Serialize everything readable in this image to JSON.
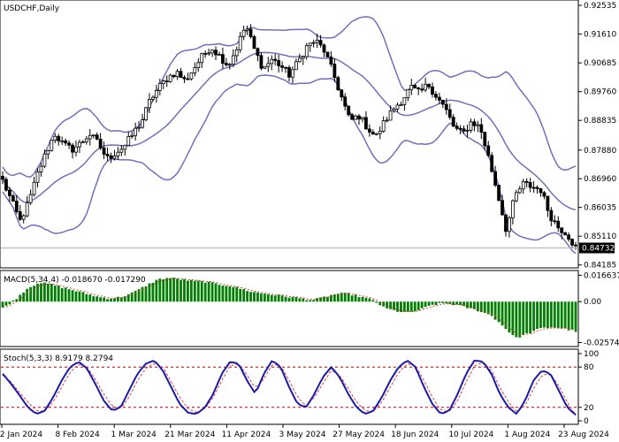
{
  "chart_data": [
    {
      "type": "candlestick",
      "title": "USDCHF,Daily",
      "y_ticks": [
        "0.92535",
        "0.91610",
        "0.90685",
        "0.89760",
        "0.88835",
        "0.87880",
        "0.86960",
        "0.86035",
        "0.85110",
        "0.84185"
      ],
      "ylim": [
        0.8412,
        0.9265
      ],
      "current_price": "0.84732",
      "x_ticks": [
        "2 Jan 2024",
        "8 Feb 2024",
        "1 Mar 2024",
        "21 Mar 2024",
        "11 Apr 2024",
        "3 May 2024",
        "27 May 2024",
        "18 Jun 2024",
        "10 Jul 2024",
        "1 Aug 2024",
        "23 Aug 2024"
      ],
      "close_path": [
        0.869,
        0.8625,
        0.856,
        0.862,
        0.871,
        0.878,
        0.884,
        0.8805,
        0.879,
        0.881,
        0.884,
        0.881,
        0.876,
        0.878,
        0.88,
        0.884,
        0.888,
        0.895,
        0.899,
        0.902,
        0.904,
        0.901,
        0.905,
        0.909,
        0.912,
        0.909,
        0.906,
        0.912,
        0.919,
        0.911,
        0.905,
        0.908,
        0.906,
        0.903,
        0.907,
        0.912,
        0.914,
        0.911,
        0.904,
        0.896,
        0.888,
        0.89,
        0.886,
        0.883,
        0.888,
        0.892,
        0.895,
        0.899,
        0.897,
        0.9,
        0.896,
        0.892,
        0.886,
        0.884,
        0.888,
        0.886,
        0.876,
        0.865,
        0.853,
        0.864,
        0.868,
        0.867,
        0.866,
        0.858,
        0.854,
        0.852,
        0.8473
      ]
    },
    {
      "type": "bar",
      "title": "MACD(5,34,4) -0.018670 -0.017290",
      "y_ticks": [
        "0.016637",
        "0.00",
        "-0.025749"
      ],
      "ylim": [
        -0.0277,
        0.0185
      ],
      "histogram_path": [
        -0.004,
        0.001,
        0.008,
        0.012,
        0.011,
        0.009,
        0.007,
        0.005,
        0.003,
        0.002,
        0.003,
        0.006,
        0.01,
        0.014,
        0.015,
        0.014,
        0.013,
        0.0125,
        0.011,
        0.01,
        0.008,
        0.006,
        0.005,
        0.004,
        0.003,
        0.002,
        0.001,
        0.003,
        0.005,
        0.005,
        0.003,
        0.001,
        -0.004,
        -0.006,
        -0.007,
        -0.005,
        -0.002,
        -0.001,
        -0.002,
        -0.004,
        -0.006,
        -0.009,
        -0.016,
        -0.023,
        -0.02,
        -0.017,
        -0.016,
        -0.017,
        -0.0187
      ],
      "signal_value": -0.01729
    },
    {
      "type": "line",
      "title": "Stoch(5,3,3) 8.9179 8.2794",
      "y_ticks": [
        "100",
        "80",
        "20",
        "0"
      ],
      "ylim": [
        0,
        100
      ],
      "levels": [
        80,
        20
      ],
      "k_path": [
        70,
        55,
        38,
        20,
        10,
        15,
        35,
        60,
        80,
        88,
        78,
        55,
        30,
        15,
        20,
        45,
        70,
        85,
        90,
        75,
        50,
        25,
        12,
        10,
        20,
        40,
        70,
        88,
        85,
        60,
        40,
        70,
        90,
        80,
        50,
        25,
        20,
        40,
        65,
        80,
        65,
        40,
        20,
        10,
        15,
        35,
        60,
        80,
        90,
        80,
        50,
        25,
        10,
        15,
        40,
        70,
        90,
        88,
        70,
        40,
        20,
        10,
        30,
        60,
        75,
        70,
        45,
        20,
        9
      ],
      "d_path": [
        68,
        58,
        42,
        28,
        15,
        14,
        28,
        50,
        72,
        84,
        80,
        62,
        40,
        22,
        18,
        35,
        60,
        78,
        86,
        80,
        58,
        35,
        18,
        12,
        18,
        35,
        60,
        82,
        85,
        68,
        48,
        62,
        84,
        82,
        60,
        35,
        22,
        35,
        55,
        75,
        68,
        48,
        28,
        15,
        14,
        28,
        50,
        72,
        85,
        82,
        60,
        35,
        15,
        14,
        30,
        58,
        82,
        87,
        75,
        50,
        28,
        14,
        22,
        48,
        68,
        70,
        52,
        28,
        8
      ]
    }
  ],
  "colors": {
    "bollinger": "#7070c0",
    "macd_bar": "#008000",
    "macd_signal": "#cc4444",
    "stoch_k": "#1a1aa8",
    "stoch_d": "#d04060",
    "level_line": "#c00000",
    "price_line": "#b0b0b0"
  }
}
